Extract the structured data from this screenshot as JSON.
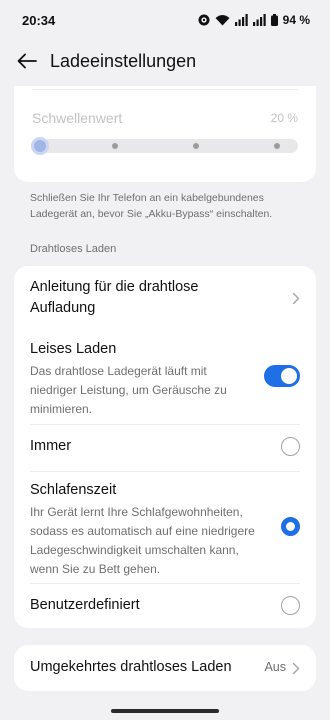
{
  "status_bar": {
    "time": "20:34",
    "battery": "94 %",
    "icons": [
      "app-notification-icon",
      "wifi-icon",
      "signal-icon",
      "signal-icon",
      "battery-icon"
    ]
  },
  "header": {
    "title": "Ladeeinstellungen",
    "back_icon": "arrow-left-icon"
  },
  "threshold": {
    "label": "Schwellenwert",
    "value": "20 %",
    "level": 0,
    "disabled": true
  },
  "bypass_note": "Schließen Sie Ihr Telefon an ein kabelgebundenes Ladegerät an, bevor Sie „Akku-Bypass“ einschalten.",
  "wireless": {
    "section_title": "Drahtloses Laden",
    "guide_label": "Anleitung für die drahtlose Aufladung",
    "quiet": {
      "title": "Leises Laden",
      "description": "Das drahtlose Ladegerät läuft mit niedriger Leistung, um Geräusche zu minimieren.",
      "enabled": true
    },
    "options": [
      {
        "title": "Immer",
        "description": "",
        "selected": false
      },
      {
        "title": "Schlafenszeit",
        "description": "Ihr Gerät lernt Ihre Schlafgewohnheiten, sodass es automatisch auf eine niedrigere Ladegeschwindigkeit umschalten kann, wenn Sie zu Bett gehen.",
        "selected": true
      },
      {
        "title": "Benutzerdefiniert",
        "description": "",
        "selected": false
      }
    ]
  },
  "reverse": {
    "label": "Umgekehrtes drahtloses Laden",
    "value": "Aus"
  },
  "colors": {
    "accent": "#1f6fe6",
    "background": "#f1f1f3",
    "card": "#ffffff",
    "secondary_text": "#6f6f6f"
  }
}
